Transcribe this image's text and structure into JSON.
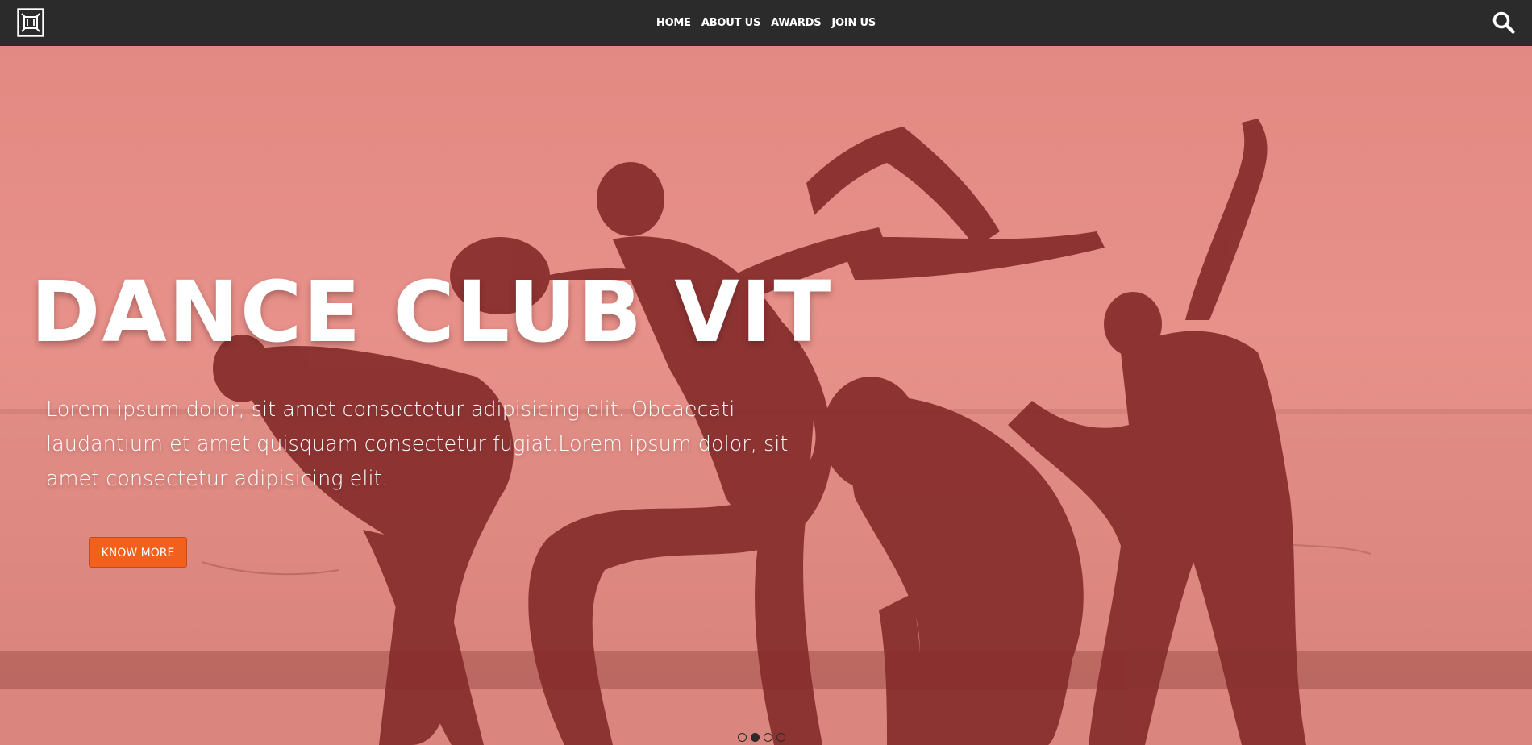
{
  "brand": {
    "logo_icon": "dance-club-logo-icon"
  },
  "nav": {
    "items": [
      {
        "label": "HOME"
      },
      {
        "label": "ABOUT US"
      },
      {
        "label": "AWARDS"
      },
      {
        "label": "JOIN US"
      }
    ],
    "search_icon": "search-icon"
  },
  "hero": {
    "title": "DANCE CLUB VIT",
    "description": "Lorem ipsum dolor, sit amet consectetur adipisicing elit. Obcaecati laudantium et amet quisquam consectetur fugiat.Lorem ipsum dolor, sit amet consectetur adipisicing elit.",
    "button_label": "KNOW MORE",
    "background_image": "group-of-dancers-photo",
    "overlay_color": "#e8857f"
  },
  "carousel": {
    "slide_count": 4,
    "active_index": 1
  },
  "colors": {
    "navbar": "#2b2b2b",
    "accent": "#f2601e",
    "text": "#ffffff"
  }
}
